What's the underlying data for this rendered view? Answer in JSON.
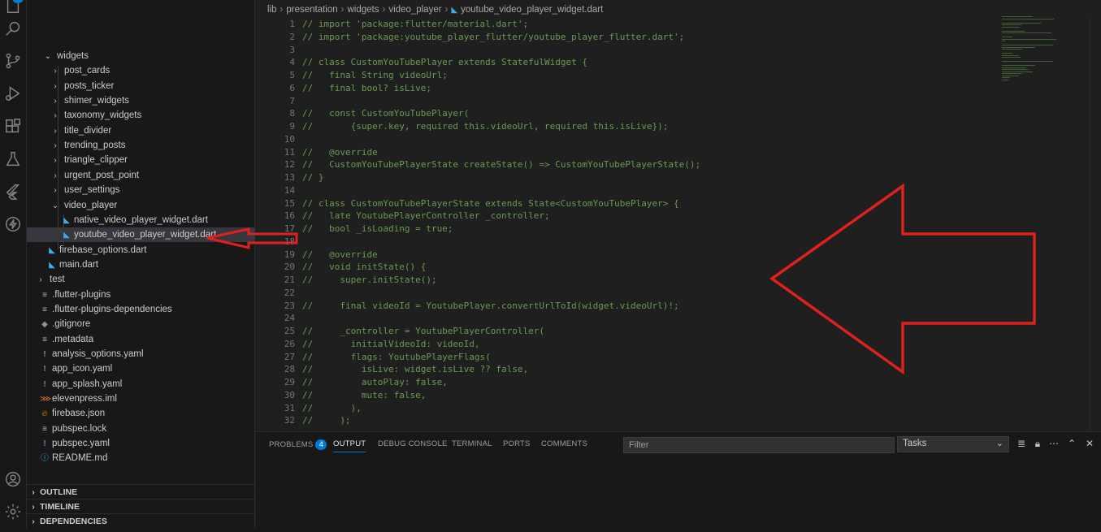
{
  "activity_bar": {
    "explorer_badge": "2",
    "icons": [
      "files-icon",
      "search-icon",
      "source-control-icon",
      "run-debug-icon",
      "extensions-icon",
      "testing-icon",
      "flutter-icon",
      "lightning-icon",
      "account-icon",
      "gear-icon"
    ]
  },
  "explorer": {
    "tree": [
      {
        "label": "widgets",
        "chevron": "⌄",
        "icon": "",
        "indent": 1
      },
      {
        "label": "post_cards",
        "chevron": "›",
        "icon": "",
        "indent": 2
      },
      {
        "label": "posts_ticker",
        "chevron": "›",
        "icon": "",
        "indent": 2
      },
      {
        "label": "shimer_widgets",
        "chevron": "›",
        "icon": "",
        "indent": 2
      },
      {
        "label": "taxonomy_widgets",
        "chevron": "›",
        "icon": "",
        "indent": 2
      },
      {
        "label": "title_divider",
        "chevron": "›",
        "icon": "",
        "indent": 2
      },
      {
        "label": "trending_posts",
        "chevron": "›",
        "icon": "",
        "indent": 2
      },
      {
        "label": "triangle_clipper",
        "chevron": "›",
        "icon": "",
        "indent": 2
      },
      {
        "label": "urgent_post_point",
        "chevron": "›",
        "icon": "",
        "indent": 2
      },
      {
        "label": "user_settings",
        "chevron": "›",
        "icon": "",
        "indent": 2
      },
      {
        "label": "video_player",
        "chevron": "⌄",
        "icon": "",
        "indent": 2
      },
      {
        "label": "native_video_player_widget.dart",
        "chevron": "",
        "icon": "dart",
        "indent": 3
      },
      {
        "label": "youtube_video_player_widget.dart",
        "chevron": "",
        "icon": "dart",
        "indent": 3,
        "selected": true
      },
      {
        "label": "firebase_options.dart",
        "chevron": "",
        "icon": "dart",
        "indent": 1
      },
      {
        "label": "main.dart",
        "chevron": "",
        "icon": "dart",
        "indent": 1
      },
      {
        "label": "test",
        "chevron": "›",
        "icon": "",
        "indent": 0
      },
      {
        "label": ".flutter-plugins",
        "chevron": "",
        "icon": "lines",
        "indent": 0
      },
      {
        "label": ".flutter-plugins-dependencies",
        "chevron": "",
        "icon": "lines",
        "indent": 0
      },
      {
        "label": ".gitignore",
        "chevron": "",
        "icon": "git",
        "indent": 0
      },
      {
        "label": ".metadata",
        "chevron": "",
        "icon": "lines",
        "indent": 0
      },
      {
        "label": "analysis_options.yaml",
        "chevron": "",
        "icon": "yaml",
        "indent": 0
      },
      {
        "label": "app_icon.yaml",
        "chevron": "",
        "icon": "yaml",
        "indent": 0
      },
      {
        "label": "app_splash.yaml",
        "chevron": "",
        "icon": "yaml",
        "indent": 0
      },
      {
        "label": "elevenpress.iml",
        "chevron": "",
        "icon": "xml",
        "indent": 0
      },
      {
        "label": "firebase.json",
        "chevron": "",
        "icon": "fire",
        "indent": 0
      },
      {
        "label": "pubspec.lock",
        "chevron": "",
        "icon": "lines",
        "indent": 0
      },
      {
        "label": "pubspec.yaml",
        "chevron": "",
        "icon": "yaml",
        "indent": 0
      },
      {
        "label": "README.md",
        "chevron": "",
        "icon": "info",
        "indent": 0
      }
    ],
    "sections": [
      "OUTLINE",
      "TIMELINE",
      "DEPENDENCIES"
    ]
  },
  "breadcrumb": [
    "lib",
    "presentation",
    "widgets",
    "video_player",
    "youtube_video_player_widget.dart"
  ],
  "code_lines": [
    {
      "n": "1",
      "t": "// import 'package:flutter/material.dart';"
    },
    {
      "n": "2",
      "t": "// import 'package:youtube_player_flutter/youtube_player_flutter.dart';"
    },
    {
      "n": "3",
      "t": ""
    },
    {
      "n": "4",
      "t": "// class CustomYouTubePlayer extends StatefulWidget {"
    },
    {
      "n": "5",
      "t": "//   final String videoUrl;"
    },
    {
      "n": "6",
      "t": "//   final bool? isLive;"
    },
    {
      "n": "7",
      "t": ""
    },
    {
      "n": "8",
      "t": "//   const CustomYouTubePlayer("
    },
    {
      "n": "9",
      "t": "//       {super.key, required this.videoUrl, required this.isLive});"
    },
    {
      "n": "10",
      "t": ""
    },
    {
      "n": "11",
      "t": "//   @override"
    },
    {
      "n": "12",
      "t": "//   CustomYouTubePlayerState createState() => CustomYouTubePlayerState();"
    },
    {
      "n": "13",
      "t": "// }"
    },
    {
      "n": "14",
      "t": ""
    },
    {
      "n": "15",
      "t": "// class CustomYouTubePlayerState extends State<CustomYouTubePlayer> {"
    },
    {
      "n": "16",
      "t": "//   late YoutubePlayerController _controller;"
    },
    {
      "n": "17",
      "t": "//   bool _isLoading = true;"
    },
    {
      "n": "18",
      "t": ""
    },
    {
      "n": "19",
      "t": "//   @override"
    },
    {
      "n": "20",
      "t": "//   void initState() {"
    },
    {
      "n": "21",
      "t": "//     super.initState();"
    },
    {
      "n": "22",
      "t": ""
    },
    {
      "n": "23",
      "t": "//     final videoId = YoutubePlayer.convertUrlToId(widget.videoUrl)!;"
    },
    {
      "n": "24",
      "t": ""
    },
    {
      "n": "25",
      "t": "//     _controller = YoutubePlayerController("
    },
    {
      "n": "26",
      "t": "//       initialVideoId: videoId,"
    },
    {
      "n": "27",
      "t": "//       flags: YoutubePlayerFlags("
    },
    {
      "n": "28",
      "t": "//         isLive: widget.isLive ?? false,"
    },
    {
      "n": "29",
      "t": "//         autoPlay: false,"
    },
    {
      "n": "30",
      "t": "//         mute: false,"
    },
    {
      "n": "31",
      "t": "//       ),"
    },
    {
      "n": "32",
      "t": "//     );"
    }
  ],
  "panel": {
    "tabs": [
      {
        "label": "PROBLEMS",
        "count": "4"
      },
      {
        "label": "OUTPUT",
        "active": true
      },
      {
        "label": "DEBUG CONSOLE"
      },
      {
        "label": "TERMINAL"
      },
      {
        "label": "PORTS"
      },
      {
        "label": "COMMENTS"
      }
    ],
    "filter_placeholder": "Filter",
    "tasks_value": "Tasks",
    "icons": [
      "list-icon",
      "lock-icon",
      "more-icon",
      "maximize-icon",
      "close-icon"
    ]
  },
  "colors": {
    "comment": "#6a9955",
    "annotation": "#e0201f",
    "accent": "#0078d4"
  }
}
